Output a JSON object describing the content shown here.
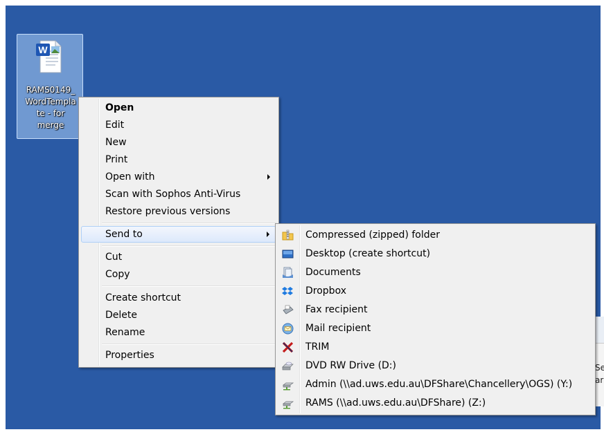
{
  "file": {
    "label": "RAMS0149_\nWordTempla\nte - for\nmerge",
    "icon": "word-document-icon"
  },
  "background_window": {
    "text1": "Se",
    "text2": "ar"
  },
  "context_menu": {
    "items": [
      {
        "label": "Open"
      },
      {
        "label": "Edit"
      },
      {
        "label": "New"
      },
      {
        "label": "Print"
      },
      {
        "label": "Open with"
      },
      {
        "label": "Scan with Sophos Anti-Virus"
      },
      {
        "label": "Restore previous versions"
      },
      {
        "label": "Send to"
      },
      {
        "label": "Cut"
      },
      {
        "label": "Copy"
      },
      {
        "label": "Create shortcut"
      },
      {
        "label": "Delete"
      },
      {
        "label": "Rename"
      },
      {
        "label": "Properties"
      }
    ]
  },
  "sendto_menu": {
    "items": [
      {
        "label": "Compressed (zipped) folder",
        "icon": "zip-folder-icon"
      },
      {
        "label": "Desktop (create shortcut)",
        "icon": "desktop-icon"
      },
      {
        "label": "Documents",
        "icon": "documents-icon"
      },
      {
        "label": "Dropbox",
        "icon": "dropbox-icon"
      },
      {
        "label": "Fax recipient",
        "icon": "fax-icon"
      },
      {
        "label": "Mail recipient",
        "icon": "mail-icon"
      },
      {
        "label": "TRIM",
        "icon": "trim-icon"
      },
      {
        "label": "DVD RW Drive (D:)",
        "icon": "dvd-drive-icon"
      },
      {
        "label": "Admin (\\\\ad.uws.edu.au\\DFShare\\Chancellery\\OGS) (Y:)",
        "icon": "network-drive-icon"
      },
      {
        "label": "RAMS (\\\\ad.uws.edu.au\\DFShare) (Z:)",
        "icon": "network-drive-icon"
      }
    ]
  },
  "colors": {
    "desktop": "#2a5aa5",
    "menu_bg": "#f0f0f0",
    "highlight_border": "#aecff7"
  }
}
